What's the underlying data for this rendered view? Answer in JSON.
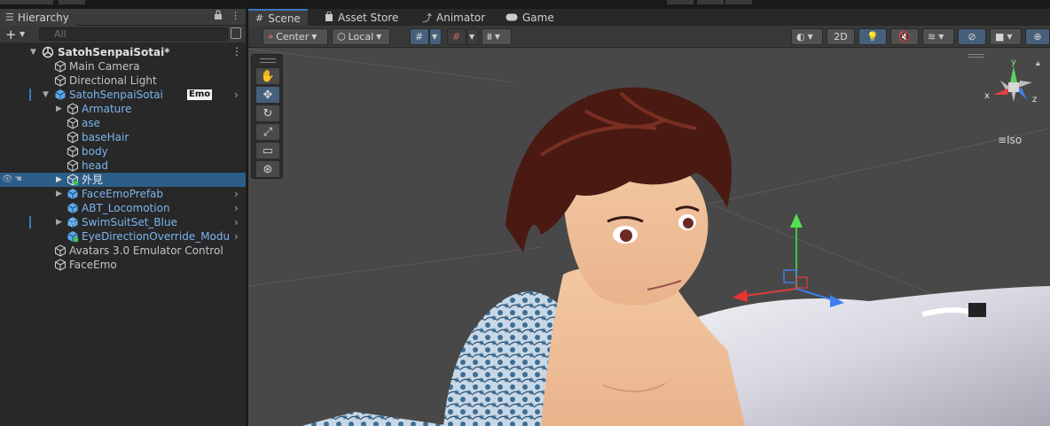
{
  "hierarchy": {
    "tab_label": "Hierarchy",
    "search_placeholder": "All",
    "root": {
      "label": "SatohSenpaiSotai*"
    },
    "items": [
      {
        "label": "Main Camera"
      },
      {
        "label": "Directional Light"
      },
      {
        "label": "SatohSenpaiSotai",
        "badge": "Emo"
      },
      {
        "label": "Armature"
      },
      {
        "label": "ase"
      },
      {
        "label": "baseHair"
      },
      {
        "label": "body"
      },
      {
        "label": "head"
      },
      {
        "label": "外見"
      },
      {
        "label": "FaceEmoPrefab"
      },
      {
        "label": "ABT_Locomotion"
      },
      {
        "label": "SwimSuitSet_Blue"
      },
      {
        "label": "EyeDirectionOverride_Modula"
      },
      {
        "label": "Avatars 3.0 Emulator Control"
      },
      {
        "label": "FaceEmo"
      }
    ]
  },
  "scene": {
    "tabs": [
      {
        "label": "Scene",
        "icon": "grid-icon"
      },
      {
        "label": "Asset Store",
        "icon": "store-bag-icon"
      },
      {
        "label": "Animator",
        "icon": "animator-icon"
      },
      {
        "label": "Game",
        "icon": "gamepad-icon"
      }
    ],
    "toolbar": {
      "pivot_label": "Center",
      "space_label": "Local",
      "mode_2d_label": "2D"
    },
    "gizmo": {
      "x_label": "x",
      "y_label": "y",
      "z_label": "z"
    },
    "projection_label": "Iso"
  },
  "colors": {
    "selection": "#2c5d87",
    "prefab_blue": "#7bb4ee",
    "accent": "#3a79bb"
  }
}
